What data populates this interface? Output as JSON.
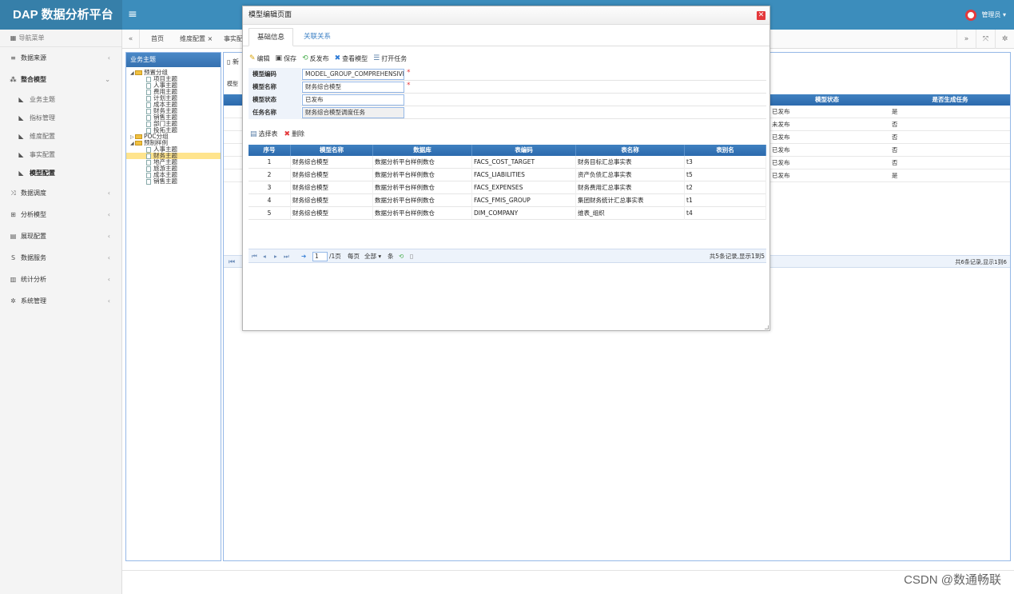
{
  "app": {
    "title": "DAP 数据分析平台",
    "user": "管理员 ▾"
  },
  "sidebar": {
    "header": "导航菜单",
    "items": [
      {
        "label": "数据来源",
        "icon": "database-icon"
      },
      {
        "label": "整合模型",
        "icon": "share-icon"
      },
      {
        "label": "数据调度",
        "icon": "shuffle-icon"
      },
      {
        "label": "分析模型",
        "icon": "sitemap-icon"
      },
      {
        "label": "展现配置",
        "icon": "layout-icon"
      },
      {
        "label": "数据服务",
        "icon": "service-icon"
      },
      {
        "label": "统计分析",
        "icon": "bar-chart-icon"
      },
      {
        "label": "系统管理",
        "icon": "gear-icon"
      }
    ],
    "subitems": [
      "业务主题",
      "指标管理",
      "维度配置",
      "事实配置",
      "模型配置"
    ]
  },
  "tabs": {
    "home": "首页",
    "dimension": "维度配置 ×",
    "fact": "事实配"
  },
  "tree": {
    "title": "业务主题",
    "nodes": [
      {
        "label": "预置分组",
        "type": "folder",
        "level": 0
      },
      {
        "label": "项目主题",
        "type": "doc",
        "level": 1
      },
      {
        "label": "人事主题",
        "type": "doc",
        "level": 1
      },
      {
        "label": "费用主题",
        "type": "doc",
        "level": 1
      },
      {
        "label": "计划主题",
        "type": "doc",
        "level": 1
      },
      {
        "label": "成本主题",
        "type": "doc",
        "level": 1
      },
      {
        "label": "财务主题",
        "type": "doc",
        "level": 1
      },
      {
        "label": "销售主题",
        "type": "doc",
        "level": 1
      },
      {
        "label": "部门主题",
        "type": "doc",
        "level": 1
      },
      {
        "label": "投拓主题",
        "type": "doc",
        "level": 1
      },
      {
        "label": "POC分组",
        "type": "folder-collapsed",
        "level": 0
      },
      {
        "label": "预制样例",
        "type": "folder",
        "level": 0
      },
      {
        "label": "人事主题",
        "type": "doc",
        "level": 1
      },
      {
        "label": "财务主题",
        "type": "doc",
        "level": 1,
        "selected": true
      },
      {
        "label": "地产主题",
        "type": "doc",
        "level": 1
      },
      {
        "label": "旅游主题",
        "type": "doc",
        "level": 1
      },
      {
        "label": "成本主题",
        "type": "doc",
        "level": 1
      },
      {
        "label": "销售主题",
        "type": "doc",
        "level": 1
      }
    ]
  },
  "background": {
    "new_button": "新",
    "label": "模型",
    "headers": [
      "模型状态",
      "是否生成任务"
    ],
    "rows": [
      [
        "已发布",
        "是"
      ],
      [
        "未发布",
        "否"
      ],
      [
        "已发布",
        "否"
      ],
      [
        "已发布",
        "否"
      ],
      [
        "已发布",
        "否"
      ],
      [
        "已发布",
        "是"
      ]
    ],
    "pager_info": "共6条记录,显示1到6"
  },
  "modal": {
    "title": "模型编辑页面",
    "tabs": [
      "基础信息",
      "关联关系"
    ],
    "toolbar": [
      "编辑",
      "保存",
      "反发布",
      "查看模型",
      "打开任务"
    ],
    "form": [
      {
        "label": "模型编码",
        "value": "MODEL_GROUP_COMPREHENSIVE",
        "required": true,
        "readonly": false
      },
      {
        "label": "模型名称",
        "value": "财务综合模型",
        "required": true,
        "readonly": false
      },
      {
        "label": "模型状态",
        "value": "已发布",
        "required": false,
        "readonly": false
      },
      {
        "label": "任务名称",
        "value": "财务综合模型调度任务",
        "required": false,
        "readonly": true
      }
    ],
    "subtools": [
      "选择表",
      "删除"
    ],
    "grid": {
      "headers": [
        "序号",
        "模型名称",
        "数据库",
        "表编码",
        "表名称",
        "表别名"
      ],
      "rows": [
        [
          "1",
          "财务综合模型",
          "数据分析平台样例数仓",
          "FACS_COST_TARGET",
          "财务目标汇总事实表",
          "t3"
        ],
        [
          "2",
          "财务综合模型",
          "数据分析平台样例数仓",
          "FACS_LIABILITIES",
          "资产负债汇总事实表",
          "t5"
        ],
        [
          "3",
          "财务综合模型",
          "数据分析平台样例数仓",
          "FACS_EXPENSES",
          "财务费用汇总事实表",
          "t2"
        ],
        [
          "4",
          "财务综合模型",
          "数据分析平台样例数仓",
          "FACS_FMIS_GROUP",
          "集团财务统计汇总事实表",
          "t1"
        ],
        [
          "5",
          "财务综合模型",
          "数据分析平台样例数仓",
          "DIM_COMPANY",
          "维表_组织",
          "t4"
        ]
      ]
    },
    "pager": {
      "page": "1",
      "total_pages": "/1页",
      "per_page": "每页",
      "per_page_value": "全部 ▾",
      "unit": "条",
      "info": "共5条记录,显示1到5"
    }
  },
  "watermark": "CSDN @数通畅联"
}
